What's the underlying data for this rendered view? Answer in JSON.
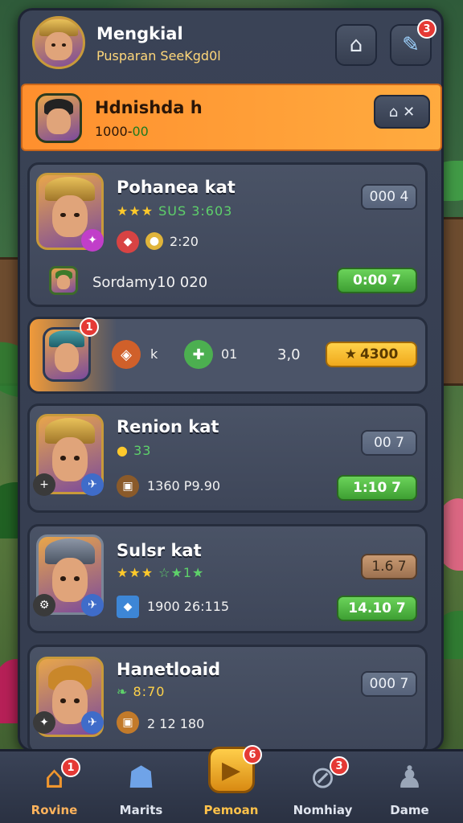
{
  "header": {
    "player_name": "Mengkial",
    "subtitle": "Pusparan SeeKgd0l",
    "home_icon": "home-icon",
    "edit_icon": "pencil-icon",
    "edit_badge": "3"
  },
  "banner": {
    "name": "Hdnishda h",
    "value_prefix": "1000-",
    "value_suffix": "00",
    "button_icon": "close-icon"
  },
  "heroes": [
    {
      "name": "Pohanea kat",
      "stars_text": "★★★",
      "rating": "SUS 3:603",
      "item_text": "2:20",
      "pill": "000 4",
      "row_text": "Sordamy10 020",
      "action": "0:00 7"
    },
    {
      "name": "Renion kat",
      "stars_text": "",
      "rating": "33",
      "item_text": "1360 P9.90",
      "pill": "00 7",
      "action": "1:10 7"
    },
    {
      "name": "Sulsr kat",
      "stars_text": "★★★",
      "rating": "☆★1★",
      "item_text": "1900 26:115",
      "pill": "1.6 7",
      "action": "14.10 7"
    },
    {
      "name": "Hanetloaid",
      "stars_text": "",
      "rating": "8:70",
      "item_text": "2 12 180",
      "pill": "000 7"
    }
  ],
  "highlight_row": {
    "badge": "1",
    "item1_text": "k",
    "item2_text": "01",
    "mid_value": "3,0",
    "gold_button": "4300"
  },
  "nav": {
    "items": [
      {
        "label": "Rovine",
        "icon": "home-icon",
        "badge": "1"
      },
      {
        "label": "Marits",
        "icon": "crowd-icon"
      },
      {
        "label": "Pemoan",
        "icon": "shield-icon",
        "badge": "6"
      },
      {
        "label": "Nomhiay",
        "icon": "chat-icon",
        "badge": "3"
      },
      {
        "label": "Dame",
        "icon": "profile-icon"
      }
    ]
  },
  "colors": {
    "accent_orange": "#ff8f2e",
    "panel": "#3a4356",
    "green_button": "#4fbf40",
    "gold_button": "#f0a91c"
  }
}
